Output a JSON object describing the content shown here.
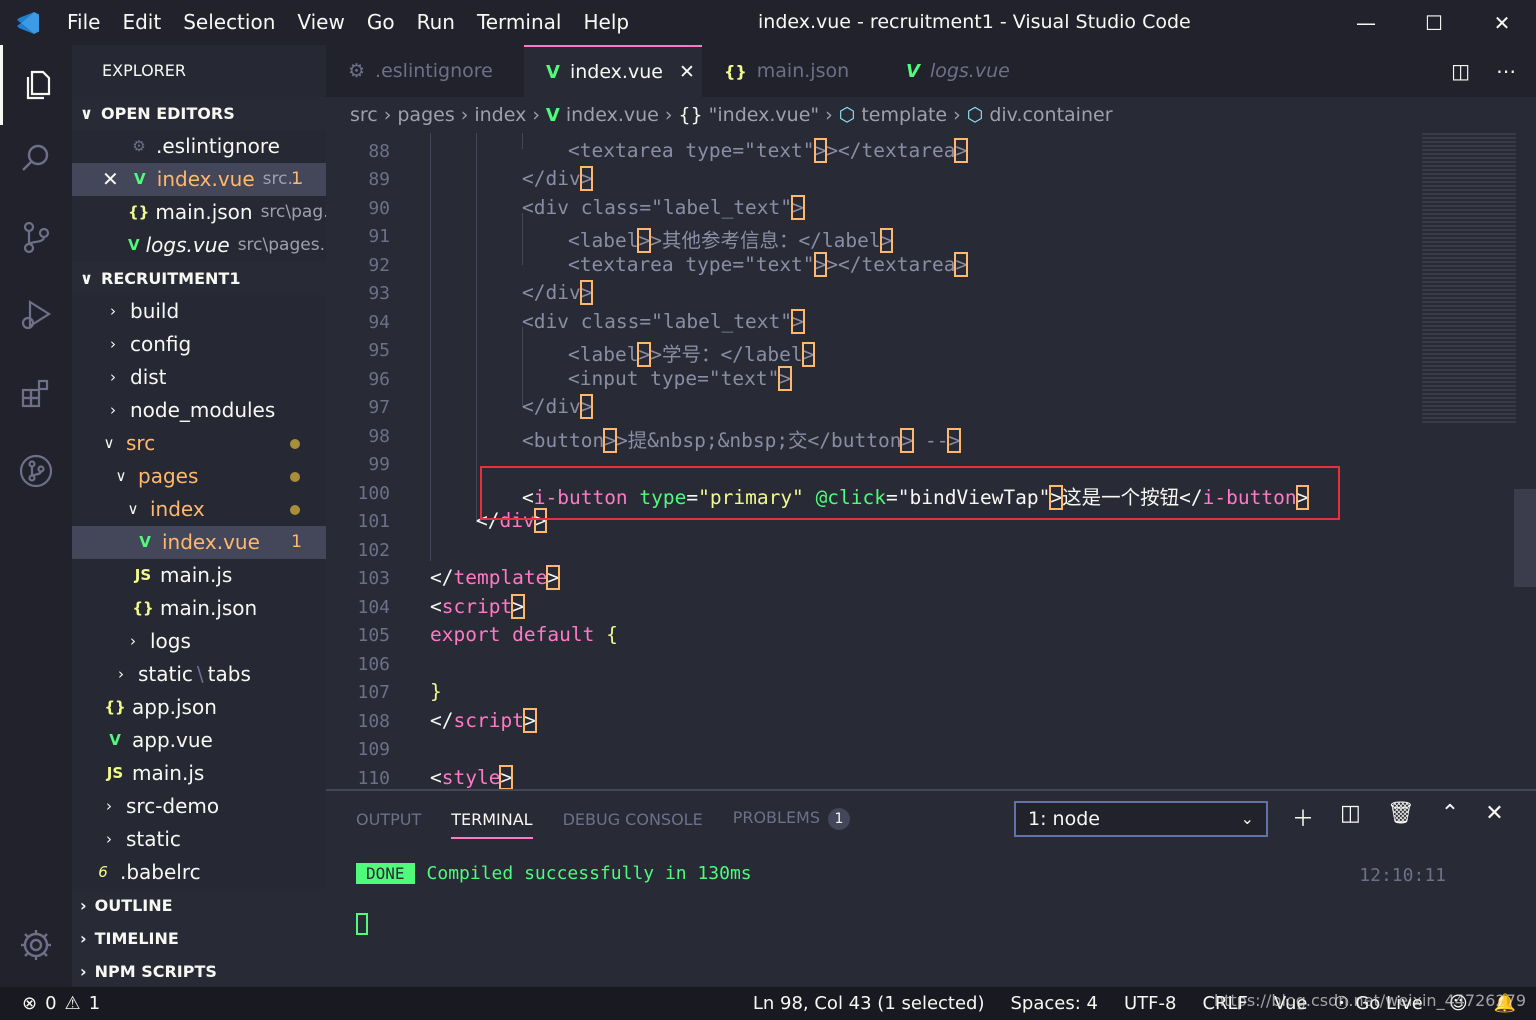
{
  "window": {
    "title": "index.vue - recruitment1 - Visual Studio Code"
  },
  "menu": [
    "File",
    "Edit",
    "Selection",
    "View",
    "Go",
    "Run",
    "Terminal",
    "Help"
  ],
  "sidebar": {
    "title": "EXPLORER",
    "open_editors": {
      "header": "OPEN EDITORS",
      "items": [
        {
          "name": ".eslintignore",
          "path": "",
          "badge": ""
        },
        {
          "name": "index.vue",
          "path": "src...",
          "badge": "1"
        },
        {
          "name": "main.json",
          "path": "src\\pag...",
          "badge": ""
        },
        {
          "name": "logs.vue",
          "path": "src\\pages...",
          "badge": ""
        }
      ]
    },
    "project": {
      "header": "RECRUITMENT1",
      "items": [
        "build",
        "config",
        "dist",
        "node_modules",
        "src",
        "pages",
        "index",
        "index.vue",
        "main.js",
        "main.json",
        "logs",
        "static",
        "tabs",
        "app.json",
        "app.vue",
        "main.js",
        "src-demo",
        "static",
        ".babelrc"
      ],
      "index_badge": "1"
    },
    "outline": "OUTLINE",
    "timeline": "TIMELINE",
    "npm": "NPM SCRIPTS"
  },
  "tabs": [
    ".eslintignore",
    "index.vue",
    "main.json",
    "logs.vue"
  ],
  "breadcrumb": [
    "src",
    "pages",
    "index",
    "index.vue",
    "\"index.vue\"",
    "template",
    "div.container"
  ],
  "editor": {
    "line_numbers": [
      "88",
      "89",
      "90",
      "91",
      "92",
      "93",
      "94",
      "95",
      "96",
      "97",
      "98",
      "99",
      "100",
      "101",
      "102",
      "103",
      "104",
      "105",
      "106",
      "107",
      "108",
      "109",
      "110"
    ],
    "lines": {
      "l88a": "<textarea type=\"text\"",
      "l88b": "></textarea",
      "l89": "</div",
      "l90a": "<div class=\"label_text\"",
      "l91a": "<label",
      "l91b": ">其他参考信息：</label",
      "l92a": "<textarea type=\"text\"",
      "l92b": "></textarea",
      "l93": "</div",
      "l94a": "<div class=\"label_text\"",
      "l95a": "<label",
      "l95b": ">学号：</label",
      "l96a": "<input type=\"text\"",
      "l97": "</div",
      "l98a": "<button",
      "l98b": ">提&nbsp;&nbsp;交</button",
      "l98c": " --",
      "l100_tag": "i-button",
      "l100_attr1": "type",
      "l100_val1": "\"primary\"",
      "l100_attr2": "@click",
      "l100_val2": "\"bindViewTap\"",
      "l100_text": "这是一个按钮",
      "l101": "div",
      "l103": "template",
      "l104": "script",
      "l105a": "export default",
      "l105b": "{",
      "l107": "}",
      "l108": "script",
      "l110": "style"
    }
  },
  "panel": {
    "tabs": [
      "OUTPUT",
      "TERMINAL",
      "DEBUG CONSOLE",
      "PROBLEMS"
    ],
    "problems_count": "1",
    "terminal_select": "1: node",
    "done": "DONE",
    "message": "Compiled successfully in 130ms",
    "time": "12:10:11"
  },
  "status": {
    "errors": "0",
    "warnings": "1",
    "position": "Ln 98, Col 43 (1 selected)",
    "spaces": "Spaces: 4",
    "encoding": "UTF-8",
    "eol": "CRLF",
    "lang": "Vue",
    "golive": "Go Live"
  },
  "watermark": "https://blog.csdn.net/weixin_44726279",
  "colors": {
    "accent": "#ff79c6",
    "green": "#50fa7b",
    "orange": "#ffb86c",
    "highlight_box": "#e3323c"
  }
}
